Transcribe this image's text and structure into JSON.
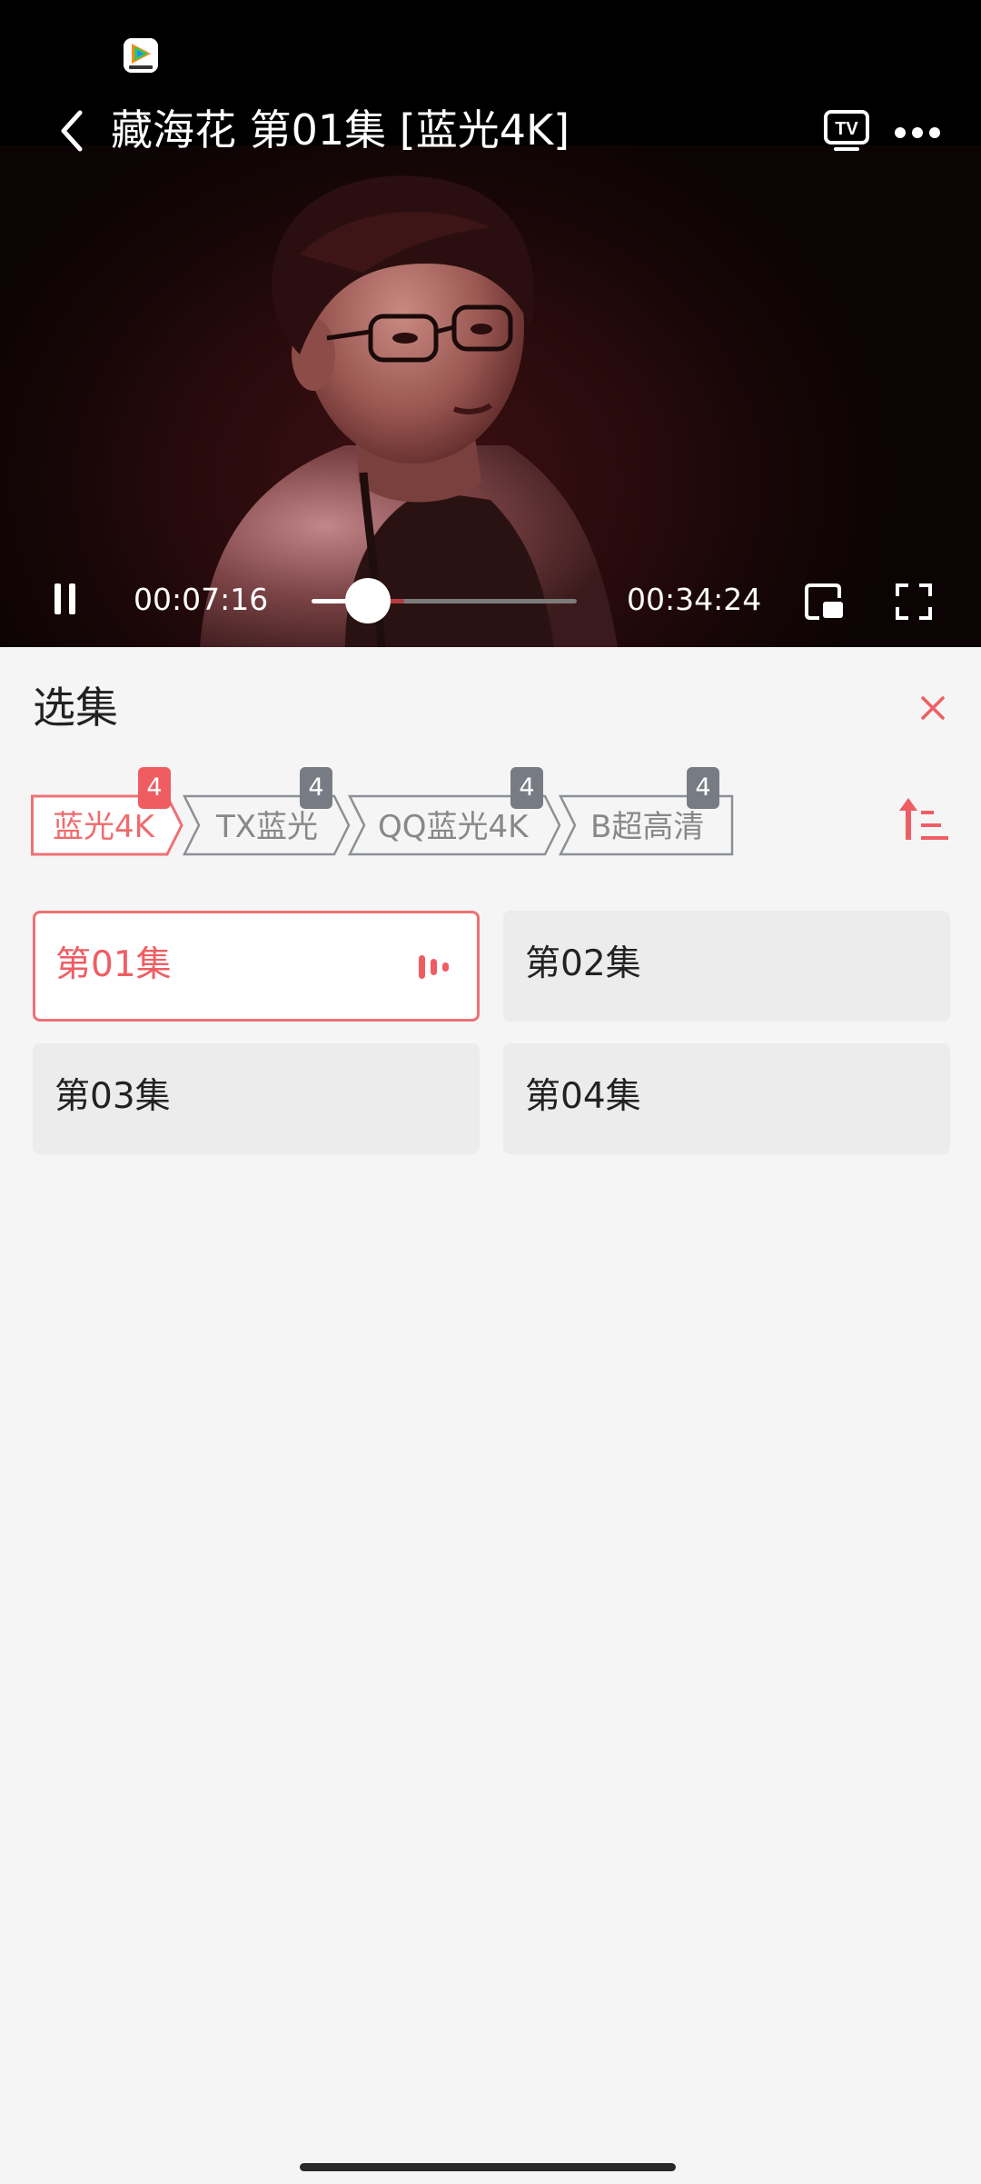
{
  "status_bar": {
    "app_icon": "tencent-video-app-icon"
  },
  "player": {
    "title": "藏海花 第01集 [蓝光4K]",
    "current_time": "00:07:16",
    "total_time": "00:34:24",
    "progress": 0.211,
    "buffered": 0.35,
    "tv_label": "TV",
    "icons": {
      "back": "chevron-left-icon",
      "cast": "tv-cast-icon",
      "more": "more-dots-icon",
      "pause": "pause-icon",
      "pip": "picture-in-picture-icon",
      "fullscreen": "fullscreen-icon"
    }
  },
  "panel": {
    "title": "选集",
    "close_icon": "close-icon",
    "sort_icon": "sort-order-icon",
    "sources": [
      {
        "label": "蓝光4K",
        "count": "4",
        "active": true
      },
      {
        "label": "TX蓝光",
        "count": "4",
        "active": false
      },
      {
        "label": "QQ蓝光4K",
        "count": "4",
        "active": false
      },
      {
        "label": "B超高清",
        "count": "4",
        "active": false
      }
    ],
    "episodes": [
      {
        "label": "第01集",
        "active": true
      },
      {
        "label": "第02集",
        "active": false
      },
      {
        "label": "第03集",
        "active": false
      },
      {
        "label": "第04集",
        "active": false
      }
    ]
  },
  "colors": {
    "accent": "#ef5d62",
    "badge_gray": "#777c84",
    "panel_bg": "#f5f5f5",
    "episode_bg": "#ececec"
  }
}
